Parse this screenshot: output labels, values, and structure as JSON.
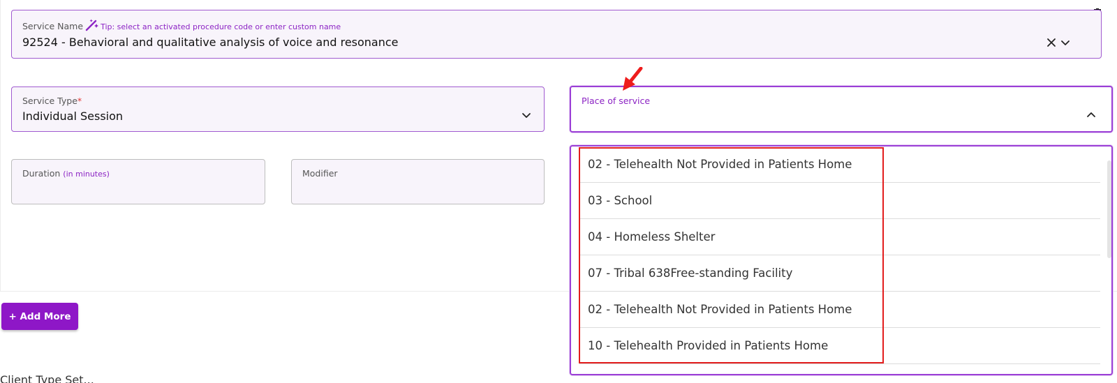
{
  "service_name": {
    "label": "Service Name",
    "tip": "Tip: select an activated procedure code or enter custom name",
    "value": "92524 - Behavioral and qualitative analysis of voice and resonance",
    "icon_wand": "magic-wand-icon",
    "icon_clear": "close-icon",
    "icon_toggle": "chevron-down-icon"
  },
  "service_type": {
    "label": "Service Type",
    "required_mark": "*",
    "value": "Individual Session",
    "icon_toggle": "chevron-down-icon"
  },
  "place_of_service": {
    "label": "Place of service",
    "icon_toggle": "chevron-up-icon",
    "options": [
      "02 - Telehealth Not Provided in Patients Home",
      "03 - School",
      "04 - Homeless Shelter",
      "07 - Tribal 638Free-standing Facility",
      "02 - Telehealth Not Provided in Patients Home",
      "10 - Telehealth Provided in Patients Home"
    ]
  },
  "duration": {
    "label": "Duration",
    "hint": "(in minutes)"
  },
  "modifier": {
    "label": "Modifier"
  },
  "actions": {
    "add_more": "+ Add More",
    "delete_icon": "trash-icon"
  },
  "annotations": {
    "arrow": "red-arrow-annotation",
    "box": "red-highlight-box"
  },
  "footer": {
    "partial_text": "Client Type Set..."
  },
  "colors": {
    "accent": "#8e17c7",
    "field_bg": "#f8f4fb",
    "highlight": "#e21d1d"
  }
}
